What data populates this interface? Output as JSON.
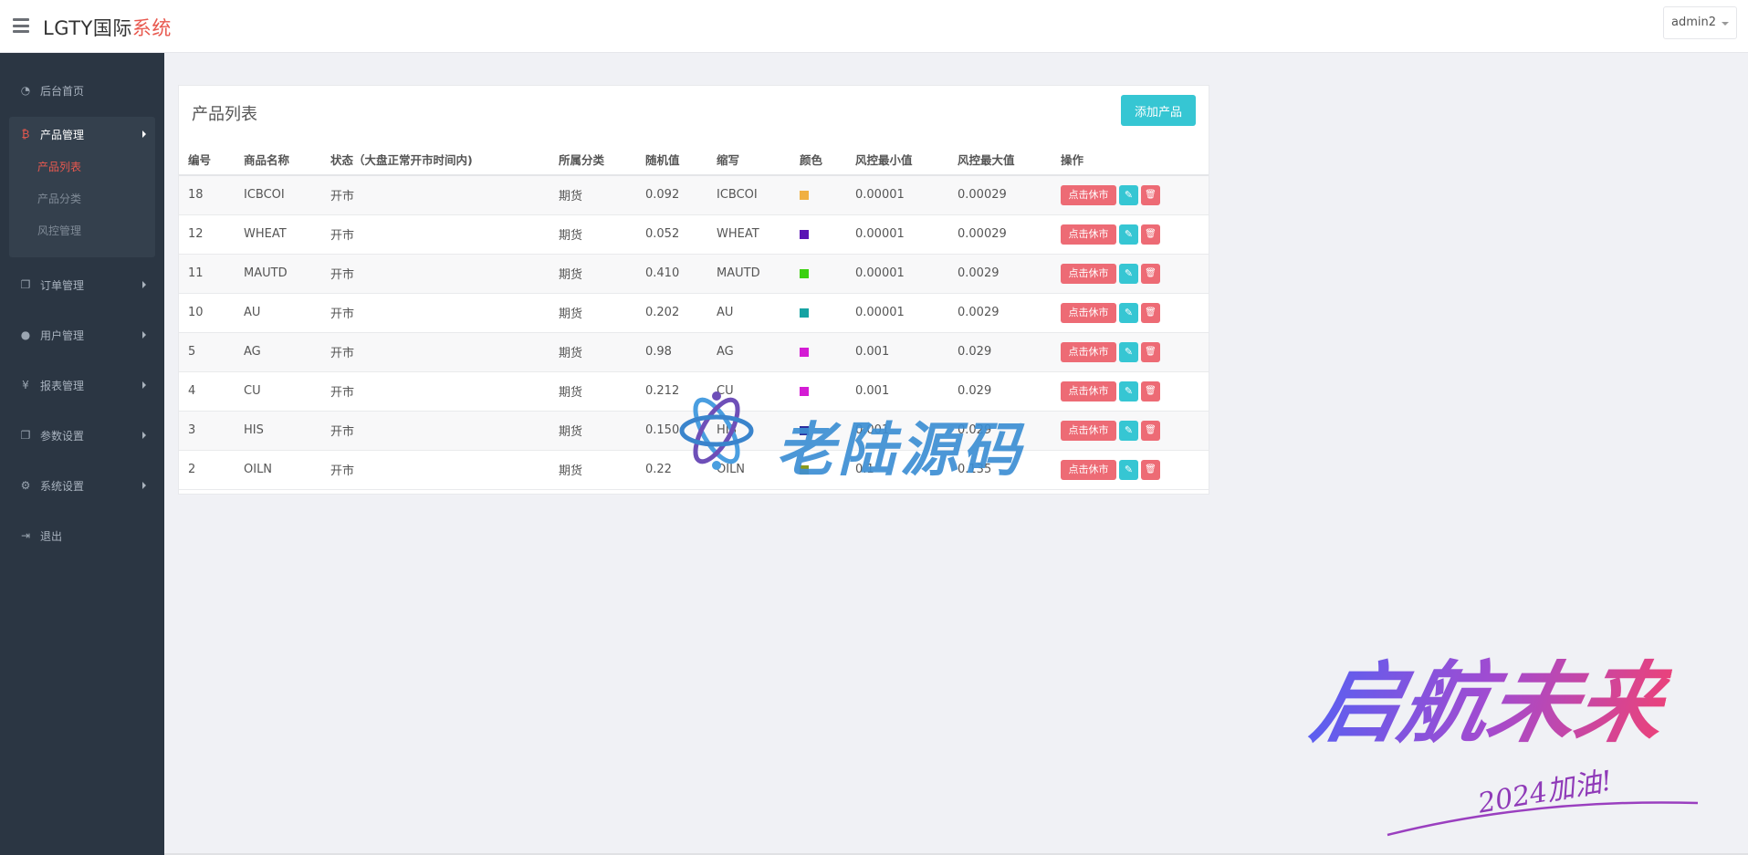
{
  "header": {
    "brand_main": "LGTY国际",
    "brand_accent": "系统",
    "user": "admin2"
  },
  "sidebar": {
    "home": "后台首页",
    "product_mgmt": "产品管理",
    "product_list": "产品列表",
    "product_category": "产品分类",
    "risk_mgmt": "风控管理",
    "order_mgmt": "订单管理",
    "user_mgmt": "用户管理",
    "report_mgmt": "报表管理",
    "param_settings": "参数设置",
    "system_settings": "系统设置",
    "logout": "退出"
  },
  "panel": {
    "title": "产品列表",
    "add_label": "添加产品"
  },
  "table": {
    "headers": [
      "编号",
      "商品名称",
      "状态（大盘正常开市时间内)",
      "所属分类",
      "随机值",
      "缩写",
      "颜色",
      "风控最小值",
      "风控最大值",
      "操作"
    ],
    "rows": [
      {
        "id": "18",
        "name": "ICBCOI",
        "status": "开市",
        "category": "期货",
        "random": "0.092",
        "abbr": "ICBCOI",
        "color": "#f0b042",
        "min": "0.00001",
        "max": "0.00029"
      },
      {
        "id": "12",
        "name": "WHEAT",
        "status": "开市",
        "category": "期货",
        "random": "0.052",
        "abbr": "WHEAT",
        "color": "#5a14b5",
        "min": "0.00001",
        "max": "0.00029"
      },
      {
        "id": "11",
        "name": "MAUTD",
        "status": "开市",
        "category": "期货",
        "random": "0.410",
        "abbr": "MAUTD",
        "color": "#3bd110",
        "min": "0.00001",
        "max": "0.0029"
      },
      {
        "id": "10",
        "name": "AU",
        "status": "开市",
        "category": "期货",
        "random": "0.202",
        "abbr": "AU",
        "color": "#16a3a3",
        "min": "0.00001",
        "max": "0.0029"
      },
      {
        "id": "5",
        "name": "AG",
        "status": "开市",
        "category": "期货",
        "random": "0.98",
        "abbr": "AG",
        "color": "#d41cd4",
        "min": "0.001",
        "max": "0.029"
      },
      {
        "id": "4",
        "name": "CU",
        "status": "开市",
        "category": "期货",
        "random": "0.212",
        "abbr": "CU",
        "color": "#d41cd4",
        "min": "0.001",
        "max": "0.029"
      },
      {
        "id": "3",
        "name": "HIS",
        "status": "开市",
        "category": "期货",
        "random": "0.150",
        "abbr": "HIS",
        "color": "#2e2e9e",
        "min": "0.001",
        "max": "0.029"
      },
      {
        "id": "2",
        "name": "OILN",
        "status": "开市",
        "category": "期货",
        "random": "0.22",
        "abbr": "OILN",
        "color": "#8a9a1a",
        "min": "0.1",
        "max": "0.135"
      }
    ],
    "action_halt": "点击休市",
    "action_edit_icon": "pencil-icon",
    "action_delete_icon": "trash-icon"
  },
  "watermarks": {
    "center": "老陆源码",
    "corner": "启航未来",
    "corner_sub": "2024加油!"
  },
  "colors": {
    "accent": "#e8594f",
    "primary": "#36c6d3",
    "danger": "#ed6b75",
    "sidebar_bg": "#2b3643"
  }
}
